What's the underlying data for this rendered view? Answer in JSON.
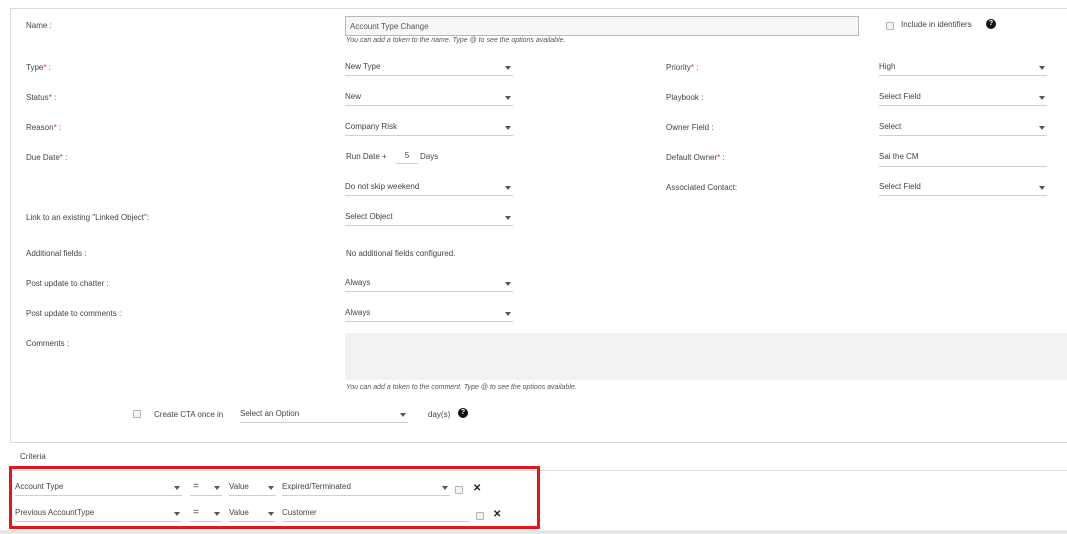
{
  "form": {
    "name_label": "Name :",
    "name_value": "Account Type Change",
    "name_hint": "You can add a token to the name. Type @ to see the options available.",
    "include_identifiers_label": "Include in identifiers",
    "help_glyph": "?",
    "required_mark": "*",
    "type_label": "Type",
    "type_value": "New Type",
    "status_label": "Status",
    "status_value": "New",
    "reason_label": "Reason",
    "reason_value": "Company Risk",
    "due_date_label": "Due Date",
    "run_date_label": "Run Date +",
    "run_date_days_value": "5",
    "days_label": "Days",
    "skip_weekend_value": "Do not skip weekend",
    "priority_label": "Priority",
    "priority_value": "High",
    "playbook_label": "Playbook :",
    "playbook_value": "Select Field",
    "owner_field_label": "Owner Field :",
    "owner_field_value": "Select",
    "default_owner_label": "Default Owner",
    "default_owner_value": "Sai the CM",
    "associated_contact_label": "Associated Contact:",
    "associated_contact_value": "Select Field",
    "linked_object_label": "Link to an existing \"Linked Object\":",
    "linked_object_value": "Select Object",
    "additional_fields_label": "Additional fields :",
    "additional_fields_value": "No additional fields configured.",
    "post_chatter_label": "Post update to chatter :",
    "post_chatter_value": "Always",
    "post_comments_label": "Post update to comments :",
    "post_comments_value": "Always",
    "comments_label": "Comments :",
    "comments_hint": "You can add a token to the comment. Type @ to see the options available.",
    "create_cta_label": "Create CTA once in",
    "create_cta_value": "Select an Option",
    "days_suffix": "day(s)"
  },
  "criteria": {
    "title": "Criteria",
    "rows": [
      {
        "field": "Account Type",
        "operator": "=",
        "value_type": "Value",
        "value": "Expired/Terminated"
      },
      {
        "field": "Previous AccountType",
        "operator": "=",
        "value_type": "Value",
        "value": "Customer"
      }
    ],
    "remove_glyph": "✕"
  },
  "colors": {
    "highlight": "#e3151e",
    "required": "#e03030",
    "textarea_bg": "#f2f2f2"
  }
}
